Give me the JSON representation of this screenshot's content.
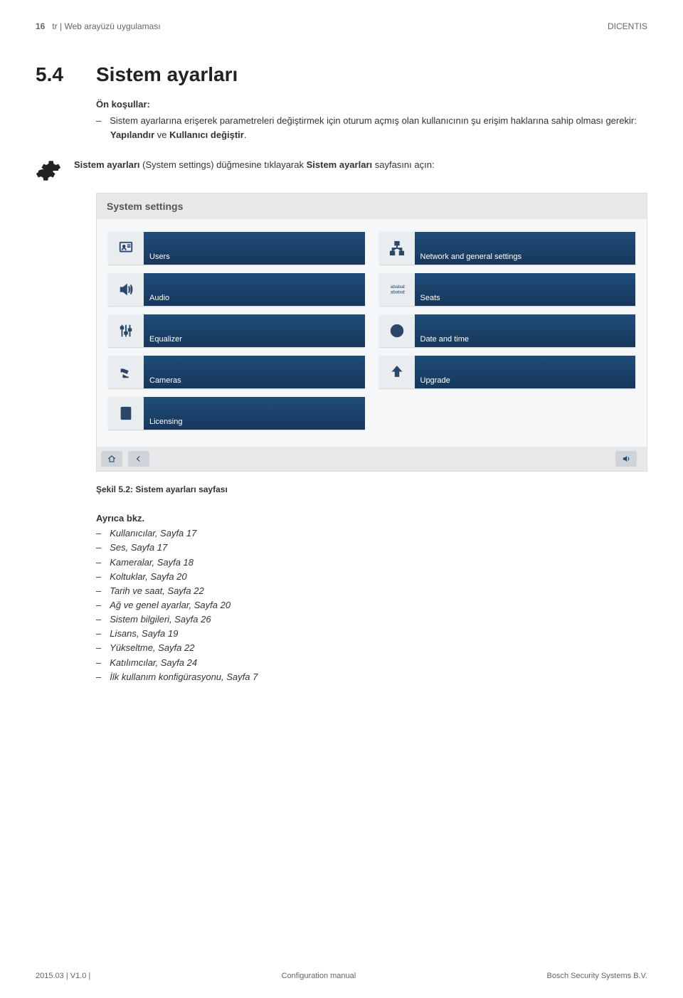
{
  "header": {
    "page_num": "16",
    "breadcrumb": "tr | Web arayüzü uygulaması",
    "product": "DICENTIS"
  },
  "section": {
    "number": "5.4",
    "title": "Sistem ayarları"
  },
  "prereq": {
    "heading": "Ön koşullar:",
    "text_before": "Sistem ayarlarına erişerek parametreleri değiştirmek için oturum açmış olan kullanıcının şu erişim haklarına sahip olması gerekir: ",
    "bold1": "Yapılandır",
    "mid": " ve ",
    "bold2": "Kullanıcı değiştir",
    "after": "."
  },
  "intro": {
    "b1": "Sistem ayarları",
    "mid1": " (System settings) düğmesine tıklayarak ",
    "b2": "Sistem ayarları",
    "tail": " sayfasını açın:"
  },
  "screenshot": {
    "title": "System settings",
    "tiles": [
      {
        "label": "Users",
        "icon": "users"
      },
      {
        "label": "Network and general settings",
        "icon": "network"
      },
      {
        "label": "Audio",
        "icon": "audio"
      },
      {
        "label": "Seats",
        "icon": "seats"
      },
      {
        "label": "Equalizer",
        "icon": "equalizer"
      },
      {
        "label": "Date and time",
        "icon": "clock"
      },
      {
        "label": "Cameras",
        "icon": "camera"
      },
      {
        "label": "Upgrade",
        "icon": "upgrade"
      },
      {
        "label": "Licensing",
        "icon": "license"
      }
    ]
  },
  "caption": "Şekil 5.2: Sistem ayarları sayfası",
  "see_also": {
    "heading": "Ayrıca bkz.",
    "items": [
      "Kullanıcılar, Sayfa 17",
      "Ses, Sayfa 17",
      "Kameralar, Sayfa 18",
      "Koltuklar, Sayfa 20",
      "Tarih ve saat, Sayfa 22",
      "Ağ ve genel ayarlar, Sayfa 20",
      "Sistem bilgileri, Sayfa 26",
      "Lisans, Sayfa 19",
      "Yükseltme, Sayfa 22",
      "Katılımcılar, Sayfa 24",
      "İlk kullanım konfigürasyonu, Sayfa 7"
    ]
  },
  "footer": {
    "left": "2015.03 | V1.0 |",
    "center": "Configuration manual",
    "right": "Bosch Security Systems B.V."
  }
}
